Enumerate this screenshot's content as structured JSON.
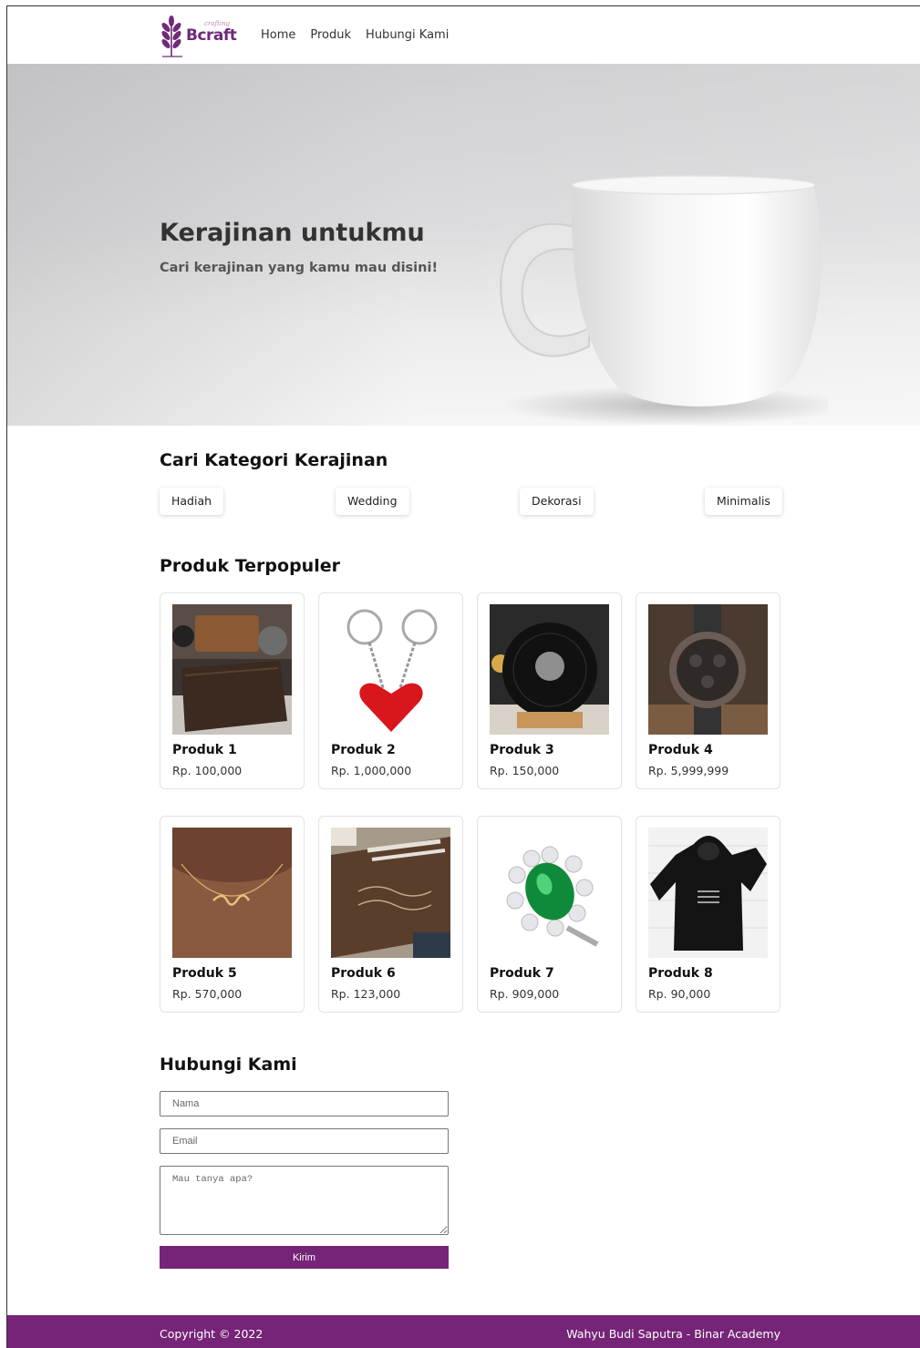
{
  "brand": {
    "name": "Bcraft",
    "tagline": "crafting"
  },
  "nav": {
    "items": [
      "Home",
      "Produk",
      "Hubungi Kami"
    ]
  },
  "hero": {
    "title": "Kerajinan untukmu",
    "subtitle": "Cari kerajinan yang kamu mau disini!"
  },
  "categories": {
    "title": "Cari Kategori Kerajinan",
    "items": [
      "Hadiah",
      "Wedding",
      "Dekorasi",
      "Minimalis"
    ]
  },
  "products": {
    "title": "Produk Terpopuler",
    "items": [
      {
        "name": "Produk 1",
        "price": "Rp. 100,000",
        "image": "leather-wallet"
      },
      {
        "name": "Produk 2",
        "price": "Rp. 1,000,000",
        "image": "heart-keychain"
      },
      {
        "name": "Produk 3",
        "price": "Rp. 150,000",
        "image": "vinyl-record-plaque"
      },
      {
        "name": "Produk 4",
        "price": "Rp. 5,999,999",
        "image": "wooden-watch"
      },
      {
        "name": "Produk 5",
        "price": "Rp. 570,000",
        "image": "name-necklace"
      },
      {
        "name": "Produk 6",
        "price": "Rp. 123,000",
        "image": "engraved-wallet"
      },
      {
        "name": "Produk 7",
        "price": "Rp. 909,000",
        "image": "emerald-ring"
      },
      {
        "name": "Produk 8",
        "price": "Rp. 90,000",
        "image": "black-hoodie"
      }
    ]
  },
  "contact": {
    "title": "Hubungi Kami",
    "name_placeholder": "Nama",
    "email_placeholder": "Email",
    "message_placeholder": "Mau tanya apa?",
    "submit_label": "Kirim"
  },
  "footer": {
    "copyright": "Copyright © 2022",
    "author": "Wahyu Budi Saputra - Binar Academy"
  },
  "colors": {
    "brand": "#762477",
    "text": "#222222"
  }
}
